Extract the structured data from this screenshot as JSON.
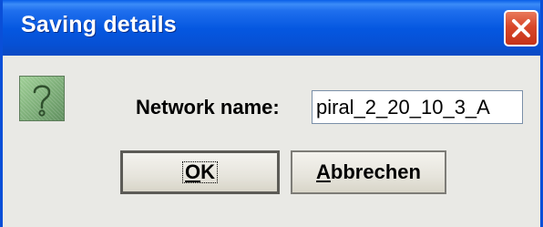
{
  "window": {
    "title": "Saving details"
  },
  "form": {
    "network_label": "Network name:",
    "network_value": "piral_2_20_10_3_A"
  },
  "buttons": {
    "ok_label": "OK",
    "cancel_label": "Abbrechen"
  },
  "icons": {
    "dialog_icon": "question-mark-icon",
    "close_icon": "close-x-icon"
  },
  "colors": {
    "titlebar": "#0557e0",
    "close_button": "#d8472a",
    "dialog_background": "#e9e9e5",
    "question_icon": "#7fb07a"
  }
}
